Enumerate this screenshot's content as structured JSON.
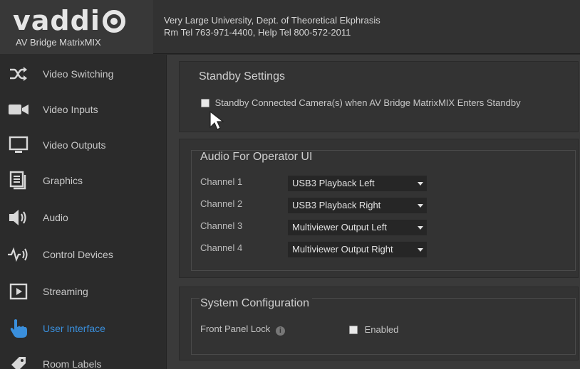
{
  "header": {
    "logo_text": "vaddi",
    "product": "AV Bridge MatrixMIX",
    "org_line1": "Very Large University, Dept. of Theoretical Ekphrasis",
    "org_line2": "Rm Tel 763-971-4400, Help Tel 800-572-2011"
  },
  "sidebar": {
    "items": [
      {
        "label": "Video Switching",
        "icon": "shuffle-icon"
      },
      {
        "label": "Video Inputs",
        "icon": "video-camera-icon"
      },
      {
        "label": "Video Outputs",
        "icon": "monitor-icon"
      },
      {
        "label": "Graphics",
        "icon": "graphics-icon"
      },
      {
        "label": "Audio",
        "icon": "speaker-icon"
      },
      {
        "label": "Control Devices",
        "icon": "control-devices-icon"
      },
      {
        "label": "Streaming",
        "icon": "play-icon"
      },
      {
        "label": "User Interface",
        "icon": "hand-pointer-icon",
        "active": true
      },
      {
        "label": "Room Labels",
        "icon": "tag-icon"
      }
    ]
  },
  "standby": {
    "title": "Standby Settings",
    "checkbox_label": "Standby Connected Camera(s) when AV Bridge MatrixMIX Enters Standby"
  },
  "audio": {
    "title": "Audio For Operator UI",
    "channels": [
      {
        "label": "Channel 1",
        "value": "USB3 Playback Left"
      },
      {
        "label": "Channel 2",
        "value": "USB3 Playback Right"
      },
      {
        "label": "Channel 3",
        "value": "Multiviewer Output Left"
      },
      {
        "label": "Channel 4",
        "value": "Multiviewer Output Right"
      }
    ]
  },
  "system": {
    "title": "System Configuration",
    "front_panel_lock_label": "Front Panel Lock",
    "enabled_label": "Enabled"
  },
  "colors": {
    "accent": "#3a8fdc",
    "background": "#3a3a3a",
    "sidebar": "#2b2b2b"
  }
}
